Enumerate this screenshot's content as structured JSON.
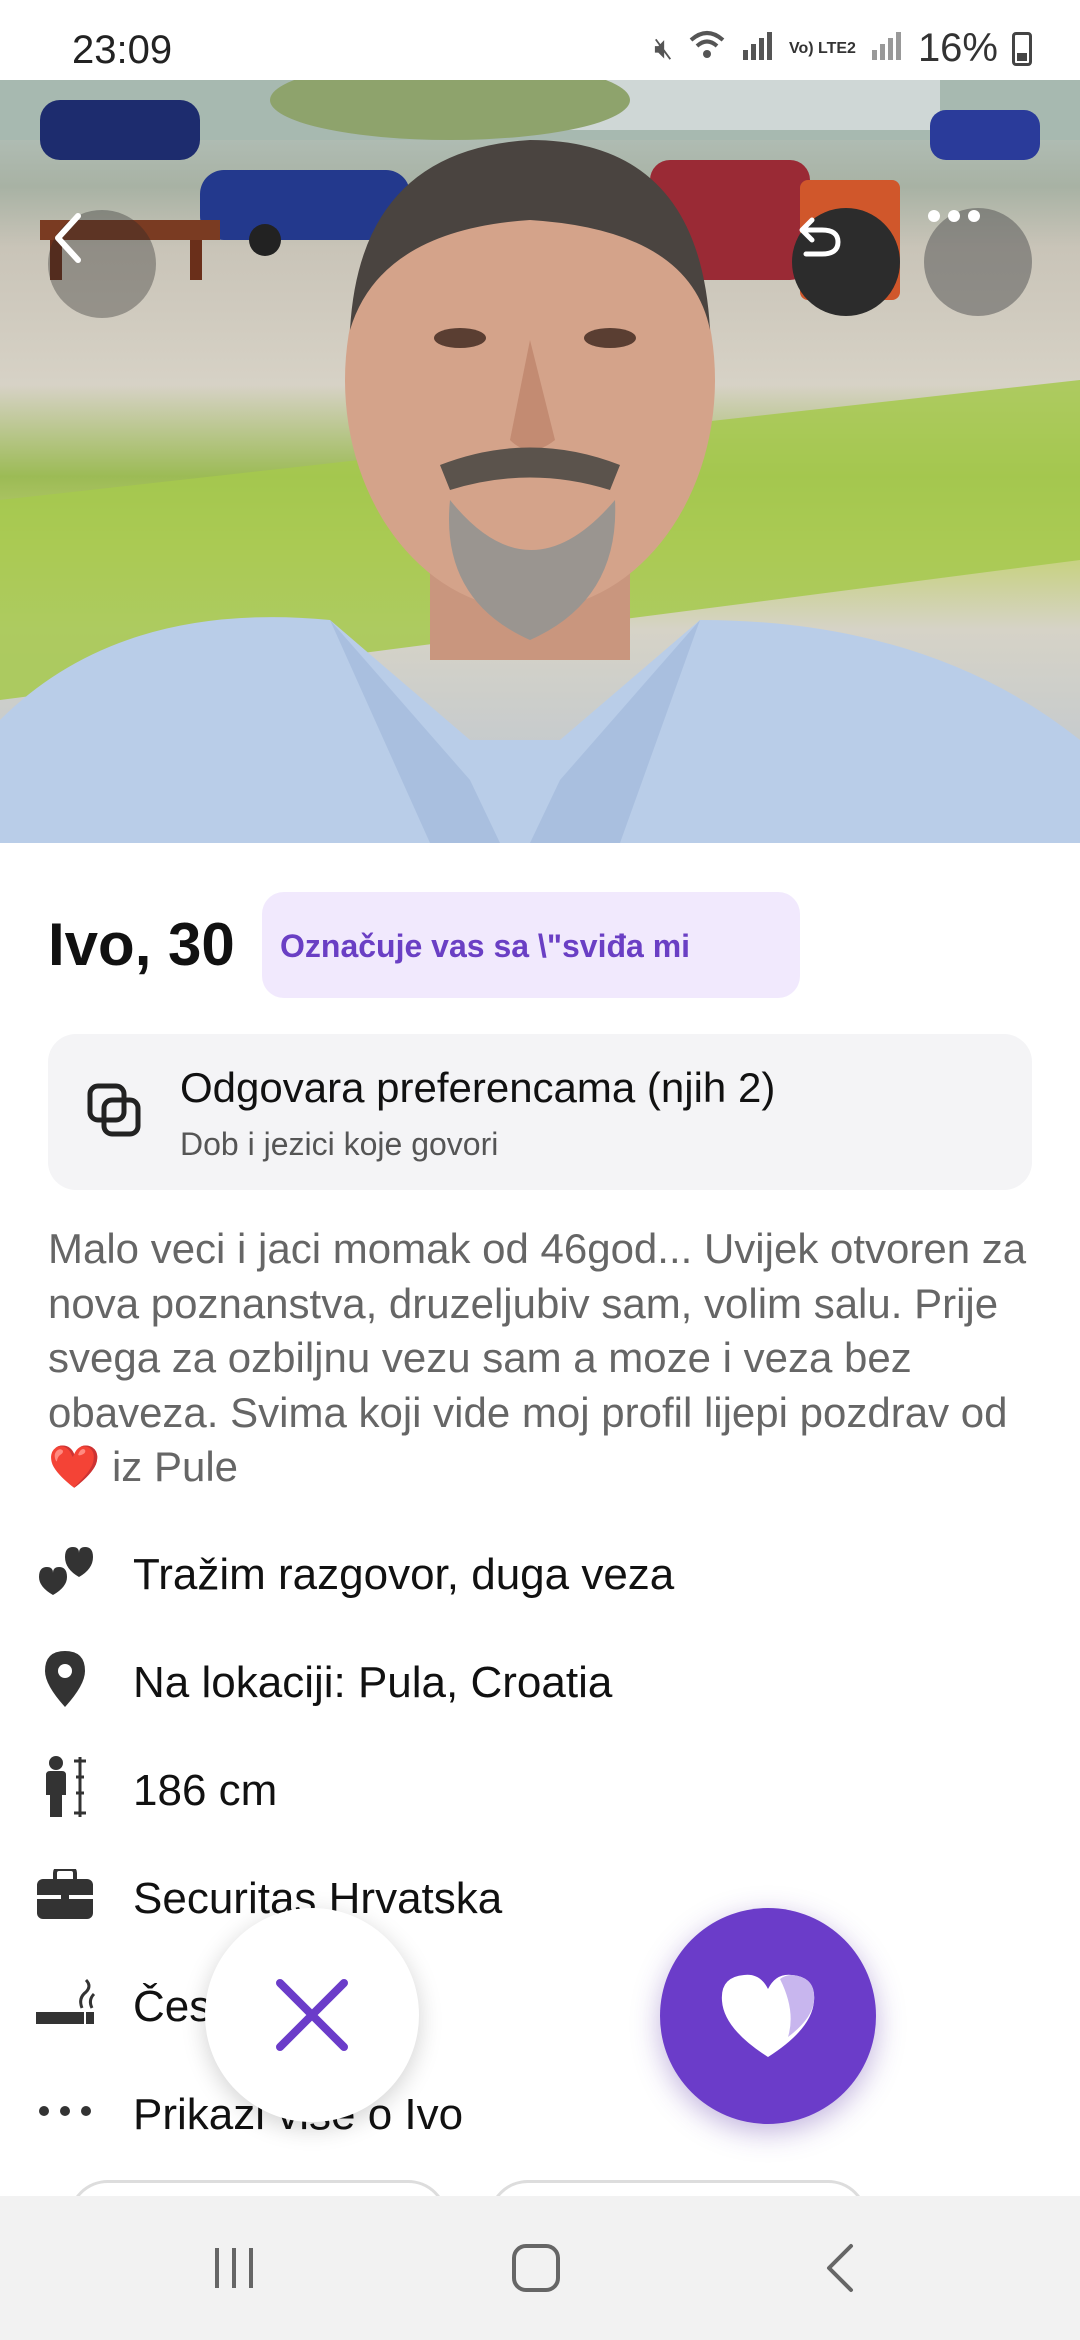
{
  "status_bar": {
    "time": "23:09",
    "network_label": "Vo) LTE2",
    "battery": "16%"
  },
  "profile": {
    "name_age": "Ivo, 30",
    "like_badge": "Označuje vas sa \\\"sviđa mi",
    "preferences": {
      "title": "Odgovara preferencama (njih 2)",
      "subtitle": "Dob i jezici koje govori"
    },
    "bio_text": "Malo veci i jaci momak od 46god...  Uvijek otvoren za  nova poznanstva, druzeljubiv sam, volim salu. Prije svega za ozbiljnu vezu sam a moze i veza bez obaveza. Svima koji vide moj profil lijepi pozdrav od",
    "bio_heart": "❤️",
    "bio_end": " iz Pule",
    "info": [
      {
        "icon": "hearts-icon",
        "label": "Tražim razgovor, duga veza"
      },
      {
        "icon": "location-pin-icon",
        "label": "Na lokaciji: Pula, Croatia"
      },
      {
        "icon": "height-icon",
        "label": "186 cm"
      },
      {
        "icon": "briefcase-icon",
        "label": "Securitas Hrvatska"
      },
      {
        "icon": "smoking-icon",
        "label": "Čes"
      },
      {
        "icon": "more-dots-icon",
        "label": "Prikazi više o Ivo"
      }
    ]
  },
  "colors": {
    "accent": "#6b3cc9",
    "badge_bg": "#f1e9fd",
    "badge_text": "#6a3fc4"
  }
}
